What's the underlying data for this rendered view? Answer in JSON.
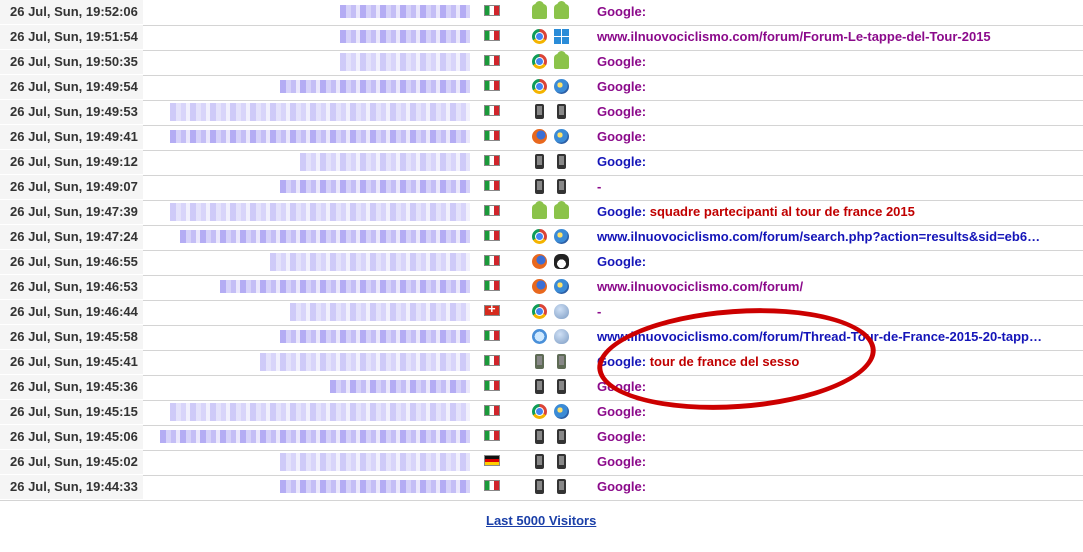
{
  "rows": [
    {
      "time": "26 Jul, Sun, 19:52:06",
      "flag": "it",
      "icons": [
        "android",
        "android"
      ],
      "ref_parts": [
        {
          "text": "Google:",
          "kind": "google"
        }
      ]
    },
    {
      "time": "26 Jul, Sun, 19:51:54",
      "flag": "it",
      "icons": [
        "chrome",
        "windows"
      ],
      "ref_parts": [
        {
          "text": "www.ilnuovociclismo.com/forum/Forum-Le-tappe-del-Tour-2015",
          "kind": "url"
        }
      ]
    },
    {
      "time": "26 Jul, Sun, 19:50:35",
      "flag": "it",
      "icons": [
        "chrome",
        "android"
      ],
      "ref_parts": [
        {
          "text": "Google:",
          "kind": "google"
        }
      ]
    },
    {
      "time": "26 Jul, Sun, 19:49:54",
      "flag": "it",
      "icons": [
        "chrome",
        "win7"
      ],
      "ref_parts": [
        {
          "text": "Google:",
          "kind": "google"
        }
      ]
    },
    {
      "time": "26 Jul, Sun, 19:49:53",
      "flag": "it",
      "icons": [
        "phone",
        "phone"
      ],
      "ref_parts": [
        {
          "text": "Google:",
          "kind": "google"
        }
      ]
    },
    {
      "time": "26 Jul, Sun, 19:49:41",
      "flag": "it",
      "icons": [
        "firefox",
        "win7"
      ],
      "ref_parts": [
        {
          "text": "Google:",
          "kind": "google"
        }
      ]
    },
    {
      "time": "26 Jul, Sun, 19:49:12",
      "flag": "it",
      "icons": [
        "phone",
        "phone"
      ],
      "ref_parts": [
        {
          "text": "Google:",
          "kind": "google-blue"
        }
      ]
    },
    {
      "time": "26 Jul, Sun, 19:49:07",
      "flag": "it",
      "icons": [
        "phone",
        "phone"
      ],
      "ref_parts": [
        {
          "text": "-",
          "kind": "url"
        }
      ]
    },
    {
      "time": "26 Jul, Sun, 19:47:39",
      "flag": "it",
      "icons": [
        "android",
        "android"
      ],
      "ref_parts": [
        {
          "text": "Google:",
          "kind": "google-blue"
        },
        {
          "text": "squadre partecipanti al tour de france 2015",
          "kind": "keyword"
        }
      ]
    },
    {
      "time": "26 Jul, Sun, 19:47:24",
      "flag": "it",
      "icons": [
        "chrome",
        "win7"
      ],
      "ref_parts": [
        {
          "text": "www.ilnuovociclismo.com/forum/search.php?action=results&sid=eb6…",
          "kind": "url-blue"
        }
      ]
    },
    {
      "time": "26 Jul, Sun, 19:46:55",
      "flag": "it",
      "icons": [
        "firefox",
        "linux"
      ],
      "ref_parts": [
        {
          "text": "Google:",
          "kind": "google-blue"
        }
      ]
    },
    {
      "time": "26 Jul, Sun, 19:46:53",
      "flag": "it",
      "icons": [
        "firefox",
        "win7"
      ],
      "ref_parts": [
        {
          "text": "www.ilnuovociclismo.com/forum/",
          "kind": "url"
        }
      ]
    },
    {
      "time": "26 Jul, Sun, 19:46:44",
      "flag": "ch",
      "icons": [
        "chrome",
        "apple"
      ],
      "ref_parts": [
        {
          "text": "-",
          "kind": "url"
        }
      ]
    },
    {
      "time": "26 Jul, Sun, 19:45:58",
      "flag": "it",
      "icons": [
        "safari",
        "apple"
      ],
      "ref_parts": [
        {
          "text": "www.ilnuovociclismo.com/forum/Thread-Tour-de-France-2015-20-tapp…",
          "kind": "url-blue"
        }
      ]
    },
    {
      "time": "26 Jul, Sun, 19:45:41",
      "flag": "it",
      "icons": [
        "phone-green",
        "phone-green"
      ],
      "ref_parts": [
        {
          "text": "Google:",
          "kind": "google-blue"
        },
        {
          "text": "tour de france del sesso",
          "kind": "keyword"
        }
      ]
    },
    {
      "time": "26 Jul, Sun, 19:45:36",
      "flag": "it",
      "icons": [
        "phone",
        "phone"
      ],
      "ref_parts": [
        {
          "text": "Google:",
          "kind": "google"
        }
      ]
    },
    {
      "time": "26 Jul, Sun, 19:45:15",
      "flag": "it",
      "icons": [
        "chrome",
        "win7"
      ],
      "ref_parts": [
        {
          "text": "Google:",
          "kind": "google"
        }
      ]
    },
    {
      "time": "26 Jul, Sun, 19:45:06",
      "flag": "it",
      "icons": [
        "phone",
        "phone"
      ],
      "ref_parts": [
        {
          "text": "Google:",
          "kind": "google"
        }
      ]
    },
    {
      "time": "26 Jul, Sun, 19:45:02",
      "flag": "de",
      "icons": [
        "phone",
        "phone"
      ],
      "ref_parts": [
        {
          "text": "Google:",
          "kind": "google"
        }
      ]
    },
    {
      "time": "26 Jul, Sun, 19:44:33",
      "flag": "it",
      "icons": [
        "phone",
        "phone"
      ],
      "ref_parts": [
        {
          "text": "Google:",
          "kind": "google"
        }
      ]
    }
  ],
  "footer": {
    "link_label": "Last 5000 Visitors"
  },
  "colors": {
    "google": "#8b0a8b",
    "link_blue": "#1414b8",
    "keyword": "#c00000",
    "annotation": "#cc0000"
  }
}
